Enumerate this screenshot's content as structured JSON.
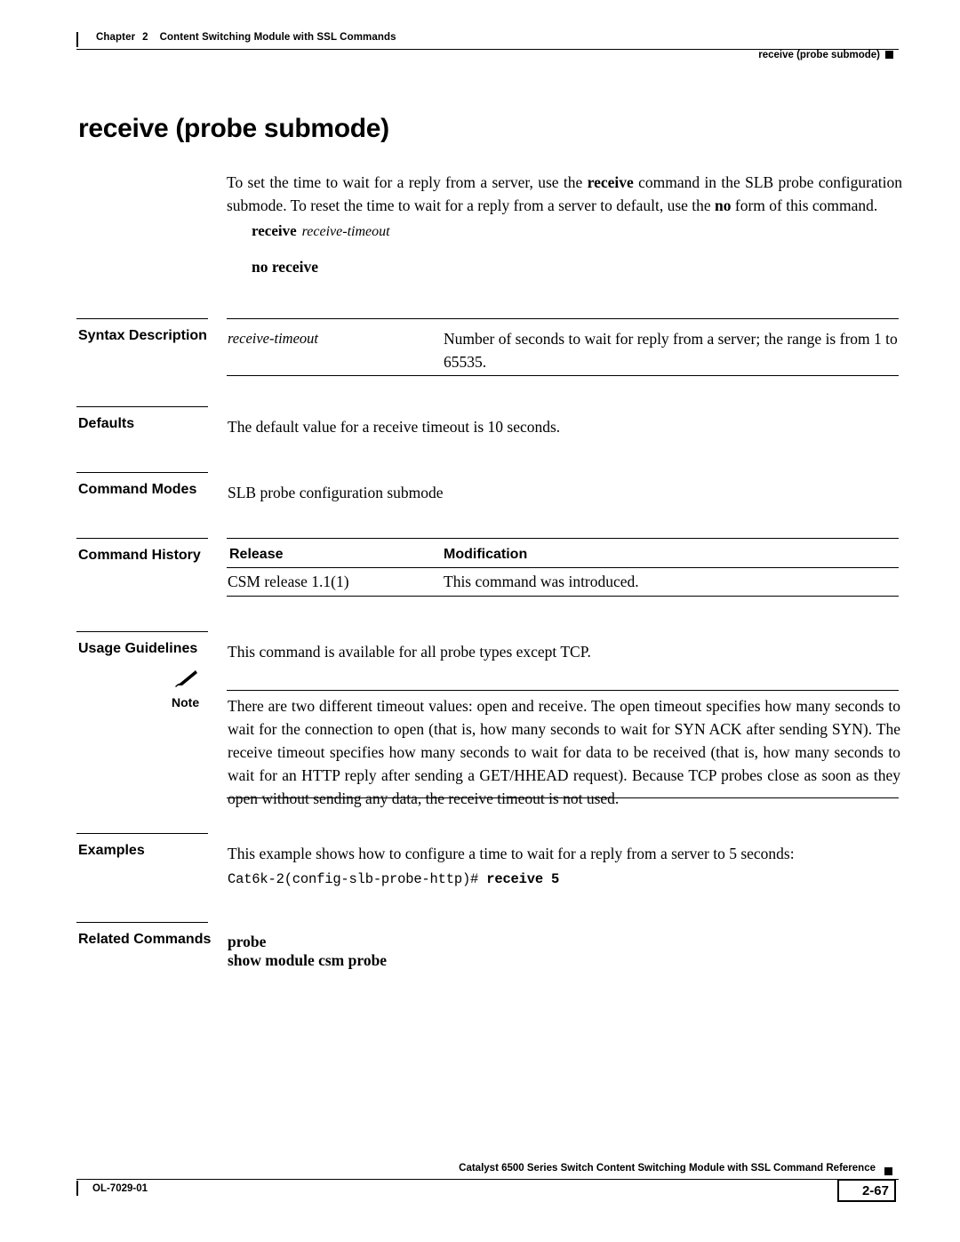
{
  "header": {
    "chapter_label": "Chapter",
    "chapter_number": "2",
    "chapter_title": "Content Switching Module with SSL Commands",
    "running_head": "receive (probe submode)"
  },
  "title": "receive (probe submode)",
  "intro": {
    "part1": "To set the time to wait for a reply from a server, use the ",
    "bold1": "receive",
    "part2": " command in the SLB probe configuration submode. To reset the time to wait for a reply from a server to default, use the ",
    "bold2": "no",
    "part3": " form of this command."
  },
  "syntax": {
    "command": "receive",
    "argument": "receive-timeout",
    "no_form": "no receive"
  },
  "sections": {
    "syntax_description": {
      "label": "Syntax Description",
      "term": "receive-timeout",
      "definition": "Number of seconds to wait for reply from a server; the range is from 1 to 65535."
    },
    "defaults": {
      "label": "Defaults",
      "text": "The default value for a receive timeout is 10 seconds."
    },
    "command_modes": {
      "label": "Command Modes",
      "text": "SLB probe configuration submode"
    },
    "command_history": {
      "label": "Command History",
      "col_release": "Release",
      "col_modification": "Modification",
      "rows": [
        {
          "release": "CSM release 1.1(1)",
          "modification": "This command was introduced."
        }
      ]
    },
    "usage_guidelines": {
      "label": "Usage Guidelines",
      "text": "This command is available for all probe types except TCP.",
      "note_label": "Note",
      "note_text": "There are two different timeout values: open and receive. The open timeout specifies how many seconds to wait for the connection to open (that is, how many seconds to wait for SYN ACK after sending SYN). The receive timeout specifies how many seconds to wait for data to be received (that is, how many seconds to wait for an HTTP reply after sending a GET/HHEAD request). Because TCP probes close as soon as they open without sending any data, the receive timeout is not used."
    },
    "examples": {
      "label": "Examples",
      "text": "This example shows how to configure a time to wait for a reply from a server to 5 seconds:",
      "code_prompt": "Cat6k-2(config-slb-probe-http)# ",
      "code_command": "receive 5"
    },
    "related_commands": {
      "label": "Related Commands",
      "items": [
        "probe",
        "show module csm probe"
      ]
    }
  },
  "footer": {
    "doc_title": "Catalyst 6500 Series Switch Content Switching Module with SSL Command Reference",
    "doc_number": "OL-7029-01",
    "page_number": "2-67"
  }
}
